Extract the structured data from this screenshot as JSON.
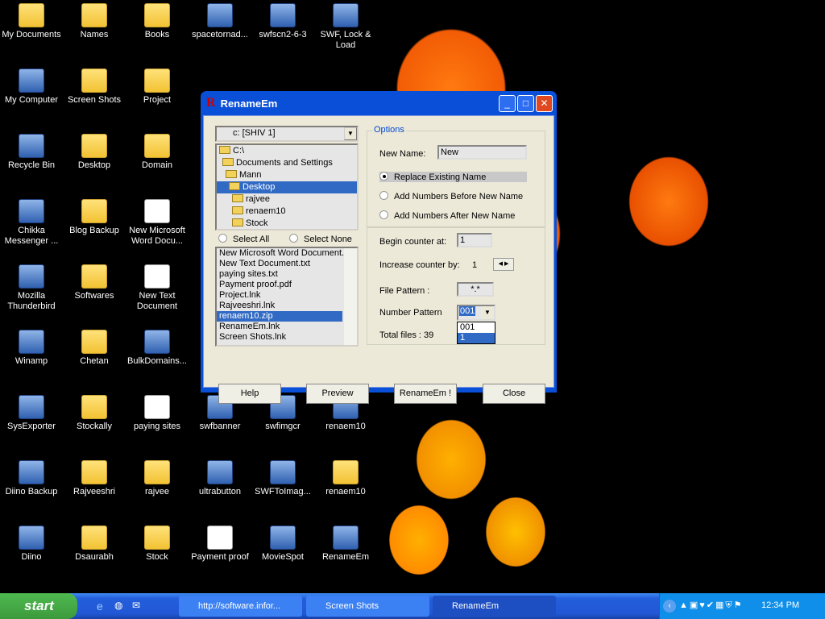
{
  "desktop": {
    "icons": [
      {
        "label": "My Documents",
        "kind": "fold"
      },
      {
        "label": "My Computer",
        "kind": "app"
      },
      {
        "label": "Recycle Bin",
        "kind": "app"
      },
      {
        "label": "Chikka Messenger ...",
        "kind": "app"
      },
      {
        "label": "Mozilla Thunderbird",
        "kind": "app"
      },
      {
        "label": "Winamp",
        "kind": "app"
      },
      {
        "label": "SysExporter",
        "kind": "app"
      },
      {
        "label": "Diino Backup",
        "kind": "app"
      },
      {
        "label": "Diino",
        "kind": "app"
      },
      {
        "label": "Names",
        "kind": "fold"
      },
      {
        "label": "Screen Shots",
        "kind": "fold"
      },
      {
        "label": "Desktop",
        "kind": "fold"
      },
      {
        "label": "Blog Backup",
        "kind": "fold"
      },
      {
        "label": "Softwares",
        "kind": "fold"
      },
      {
        "label": "Chetan",
        "kind": "fold"
      },
      {
        "label": "Stockally",
        "kind": "fold"
      },
      {
        "label": "Rajveeshri",
        "kind": "fold"
      },
      {
        "label": "Dsaurabh",
        "kind": "fold"
      },
      {
        "label": "Books",
        "kind": "fold"
      },
      {
        "label": "Project",
        "kind": "fold"
      },
      {
        "label": "Domain",
        "kind": "fold"
      },
      {
        "label": "New Microsoft Word Docu...",
        "kind": "doc"
      },
      {
        "label": "New Text Document",
        "kind": "doc"
      },
      {
        "label": "BulkDomains...",
        "kind": "app"
      },
      {
        "label": "paying sites",
        "kind": "doc"
      },
      {
        "label": "rajvee",
        "kind": "fold"
      },
      {
        "label": "Stock",
        "kind": "fold"
      },
      {
        "label": "spacetornad...",
        "kind": "app"
      },
      {
        "label": "swfbanner",
        "kind": "app"
      },
      {
        "label": "ultrabutton",
        "kind": "app"
      },
      {
        "label": "Payment proof",
        "kind": "doc"
      },
      {
        "label": "swfscn2-6-3",
        "kind": "app"
      },
      {
        "label": "swfimgcr",
        "kind": "app"
      },
      {
        "label": "SWFToImag...",
        "kind": "app"
      },
      {
        "label": "MovieSpot",
        "kind": "app"
      },
      {
        "label": "SWF, Lock & Load",
        "kind": "app"
      },
      {
        "label": "renaem10",
        "kind": "app"
      },
      {
        "label": "renaem10",
        "kind": "fold"
      },
      {
        "label": "RenameEm",
        "kind": "app"
      }
    ]
  },
  "window": {
    "title": "RenameEm",
    "drive": "c: [SHIV 1]",
    "folders": [
      "C:\\",
      "Documents and Settings",
      "Mann",
      "Desktop",
      "rajvee",
      "renaem10",
      "Stock"
    ],
    "selected_folder": "Desktop",
    "select_all": "Select All",
    "select_none": "Select None",
    "files": [
      "New Microsoft Word Document.",
      "New Text Document.txt",
      "paying sites.txt",
      "Payment proof.pdf",
      "Project.lnk",
      "Rajveeshri.lnk",
      "renaem10.zip",
      "RenameEm.lnk",
      "Screen Shots.lnk"
    ],
    "selected_file": "renaem10.zip",
    "options": {
      "legend": "Options",
      "new_name_label": "New Name:",
      "new_name_value": "New",
      "radios": [
        {
          "label": "Replace Existing Name",
          "checked": true
        },
        {
          "label": "Add Numbers Before New Name",
          "checked": false
        },
        {
          "label": "Add Numbers After New Name",
          "checked": false
        }
      ],
      "begin_label": "Begin counter at:",
      "begin_value": "1",
      "increase_label": "Increase counter by:",
      "increase_value": "1",
      "pattern_label": "File Pattern :",
      "pattern_value": "*.*",
      "number_pattern_label": "Number Pattern",
      "number_pattern_value": "001",
      "number_pattern_options": [
        "001",
        "1"
      ],
      "highlighted_option": "1",
      "total_files": "Total files : 39"
    },
    "buttons": {
      "help": "Help",
      "preview": "Preview",
      "rename": "RenameEm !",
      "close": "Close"
    }
  },
  "taskbar": {
    "start": "start",
    "tasks": [
      "http://software.infor...",
      "Screen Shots",
      "RenameEm"
    ],
    "active_task": "RenameEm",
    "clock": "12:34 PM"
  }
}
